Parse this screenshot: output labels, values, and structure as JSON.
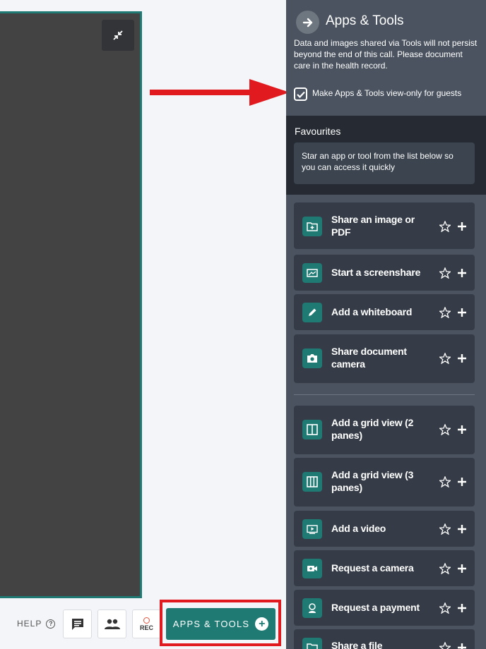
{
  "bottom_bar": {
    "help_label": "HELP",
    "help_glyph": "?",
    "rec_label": "REC",
    "apps_label": "APPS & TOOLS",
    "apps_plus": "+"
  },
  "panel": {
    "title": "Apps & Tools",
    "description": "Data and images shared via Tools will not persist beyond the end of this call. Please document care in the health record.",
    "view_only_label": "Make Apps & Tools view-only for guests",
    "view_only_checked": true,
    "favourites_title": "Favourites",
    "favourites_hint": "Star an app or tool from the list below so you can access it quickly",
    "tools_group_1": [
      {
        "label": "Share an image or PDF",
        "icon": "folder-plus-icon"
      },
      {
        "label": "Start a screenshare",
        "icon": "screen-icon"
      },
      {
        "label": "Add a whiteboard",
        "icon": "pencil-icon"
      },
      {
        "label": "Share document camera",
        "icon": "camera-icon"
      }
    ],
    "tools_group_2": [
      {
        "label": "Add a grid view (2 panes)",
        "icon": "grid-2-icon"
      },
      {
        "label": "Add a grid view (3 panes)",
        "icon": "grid-3-icon"
      },
      {
        "label": "Add a video",
        "icon": "video-play-icon"
      },
      {
        "label": "Request a camera",
        "icon": "video-camera-icon"
      },
      {
        "label": "Request a payment",
        "icon": "payment-icon"
      },
      {
        "label": "Share a file",
        "icon": "file-folder-icon"
      }
    ]
  },
  "colors": {
    "accent": "#1f7a73",
    "panel_bg": "#4a535f",
    "tile_bg": "#353c47",
    "highlight_red": "#e11a1f"
  }
}
